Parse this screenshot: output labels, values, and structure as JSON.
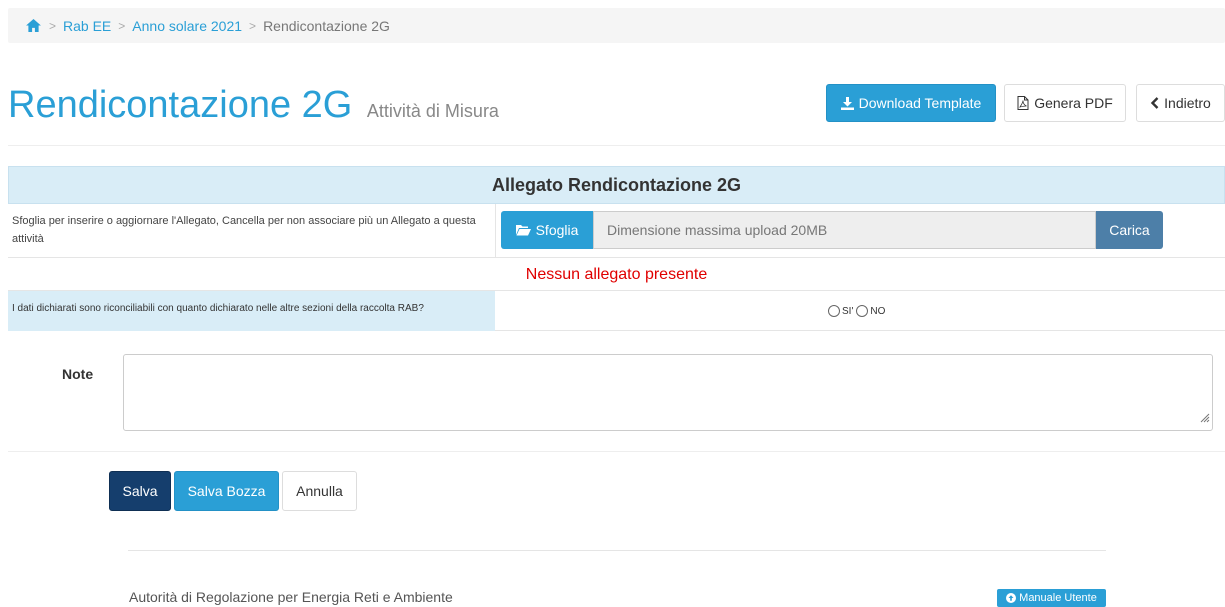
{
  "breadcrumb": {
    "items": [
      "Rab EE",
      "Anno solare 2021"
    ],
    "current": "Rendicontazione 2G",
    "separator": ">"
  },
  "header": {
    "title": "Rendicontazione 2G",
    "subtitle": "Attività di Misura",
    "download_label": "Download Template",
    "pdf_label": "Genera PDF",
    "back_label": "Indietro"
  },
  "panel": {
    "title": "Allegato Rendicontazione 2G",
    "upload_description": "Sfoglia per inserire o aggiornare l'Allegato, Cancella per non associare più un Allegato a questa attività",
    "browse_label": "Sfoglia",
    "upload_placeholder": "Dimensione massima upload 20MB",
    "upload_button": "Carica",
    "empty_message": "Nessun allegato presente",
    "question": "I dati dichiarati sono riconciliabili con quanto dichiarato nelle altre sezioni della raccolta RAB?",
    "option_yes": "SI'",
    "option_no": "NO"
  },
  "note": {
    "label": "Note",
    "value": ""
  },
  "actions": {
    "save_label": "Salva",
    "draft_label": "Salva Bozza",
    "cancel_label": "Annulla"
  },
  "footer": {
    "organization": "Autorità di Regolazione per Energia Reti e Ambiente",
    "manual_label": "Manuale Utente"
  },
  "colors": {
    "primary": "#2a9fd6",
    "dark_button": "#153e6d",
    "panel_header": "#d9edf7",
    "error": "#e00000"
  }
}
